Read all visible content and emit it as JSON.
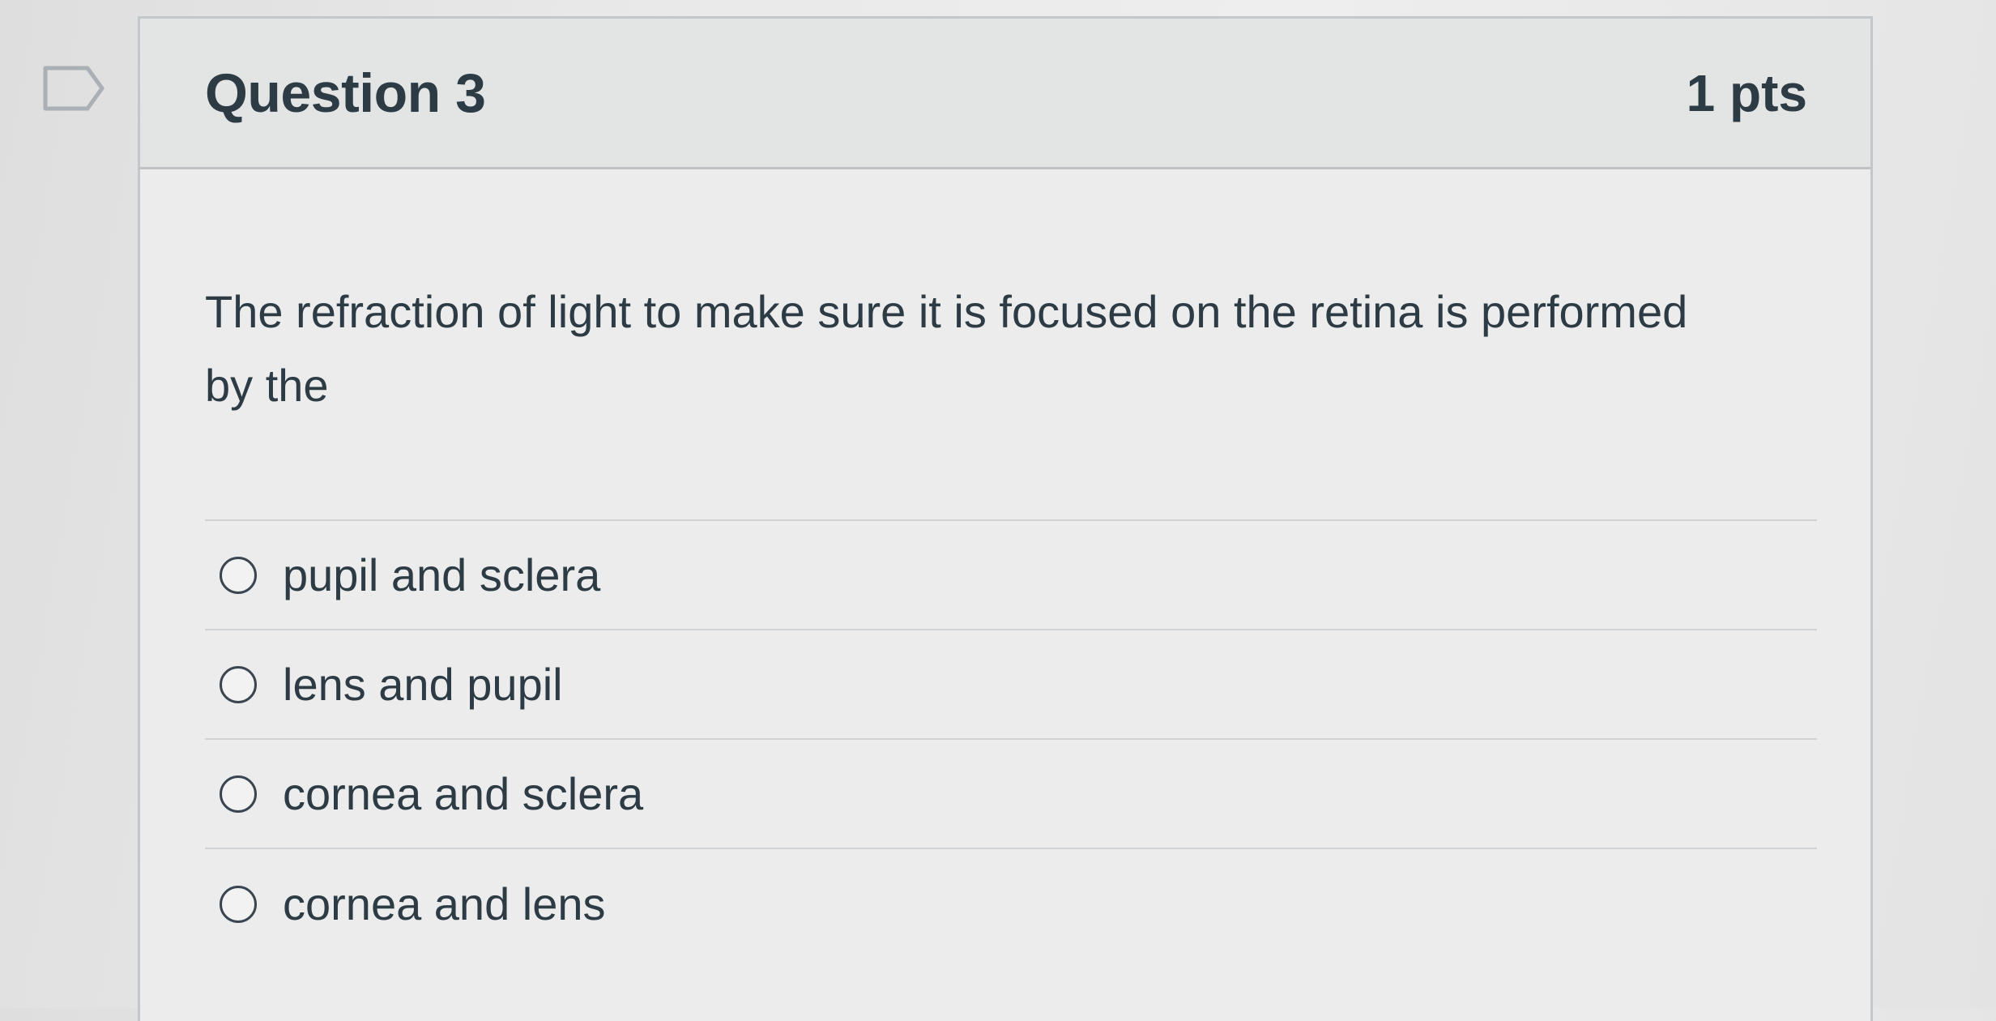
{
  "question": {
    "title": "Question 3",
    "points": "1 pts",
    "text": "The refraction of light to make sure it is focused on the retina is performed by the",
    "bookmark_icon": "bookmark-flag-icon"
  },
  "answers": [
    {
      "label": "pupil and sclera",
      "selected": false
    },
    {
      "label": "lens and pupil",
      "selected": false
    },
    {
      "label": "cornea and sclera",
      "selected": false
    },
    {
      "label": "cornea and lens",
      "selected": false
    }
  ],
  "colors": {
    "text": "#2d3b45",
    "header_bg": "#e3e4e4",
    "border": "#c4c7c9",
    "bookmark": "#aab0b5"
  }
}
